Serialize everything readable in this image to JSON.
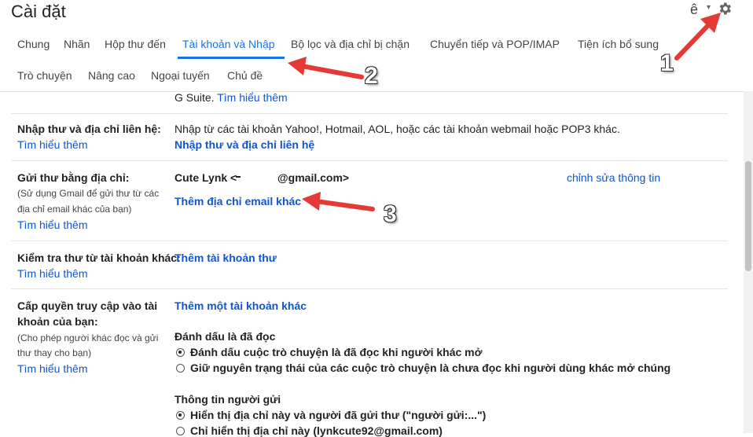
{
  "header": {
    "title": "Cài đặt",
    "lang": "ê",
    "lang_caret": "▾"
  },
  "tabs": {
    "row1": [
      "Chung",
      "Nhãn",
      "Hộp thư đến",
      "Tài khoản và Nhập",
      "Bộ lọc và địa chỉ bị chặn",
      "Chuyển tiếp và POP/IMAP",
      "Tiện ích bổ sung"
    ],
    "row2": [
      "Trò chuyện",
      "Nâng cao",
      "Ngoại tuyến",
      "Chủ đề"
    ],
    "active": "Tài khoản và Nhập"
  },
  "content": {
    "gsuite_prefix": "G Suite.",
    "gsuite_link": "Tìm hiểu thêm",
    "import_label": "Nhập thư và địa chỉ liên hệ:",
    "import_learn": "Tìm hiểu thêm",
    "import_desc": "Nhập từ các tài khoản Yahoo!, Hotmail, AOL, hoặc các tài khoản webmail hoặc POP3 khác.",
    "import_link": "Nhập thư và địa chỉ liên hệ",
    "sendas_label": "Gửi thư bằng địa chỉ:",
    "sendas_sub1": "(Sử dụng Gmail để gửi thư từ các",
    "sendas_sub2": "địa chỉ email khác của bạn)",
    "sendas_learn": "Tìm hiểu thêm",
    "sendas_name": "Cute Lynk <",
    "sendas_domain": "@gmail.com>",
    "sendas_edit": "chỉnh sửa thông tin",
    "sendas_add": "Thêm địa chỉ email khác",
    "check_label": "Kiểm tra thư từ tài khoản khác:",
    "check_learn": "Tìm hiểu thêm",
    "check_add": "Thêm tài khoản thư",
    "grant_label1": "Cấp quyền truy cập vào tài",
    "grant_label2": "khoản của bạn:",
    "grant_sub1": "(Cho phép người khác đọc và gửi",
    "grant_sub2": "thư thay cho bạn)",
    "grant_learn": "Tìm hiểu thêm",
    "grant_add": "Thêm một tài khoản khác",
    "mark_title": "Đánh dấu là đã đọc",
    "mark_opt1": "Đánh dấu cuộc trò chuyện là đã đọc khi người khác mở",
    "mark_opt2": "Giữ nguyên trạng thái của các cuộc trò chuyện là chưa đọc khi người dùng khác mở chúng",
    "sender_title": "Thông tin người gửi",
    "sender_opt1": "Hiển thị địa chỉ này và người đã gửi thư (\"người gửi:...\")",
    "sender_opt2": "Chỉ hiển thị địa chỉ này (lynkcute92@gmail.com)"
  },
  "annotations": {
    "n1": "1",
    "n2": "2",
    "n3": "3"
  },
  "colors": {
    "accent": "#1a73e8",
    "link": "#1155cc",
    "arrow": "#e53935"
  }
}
